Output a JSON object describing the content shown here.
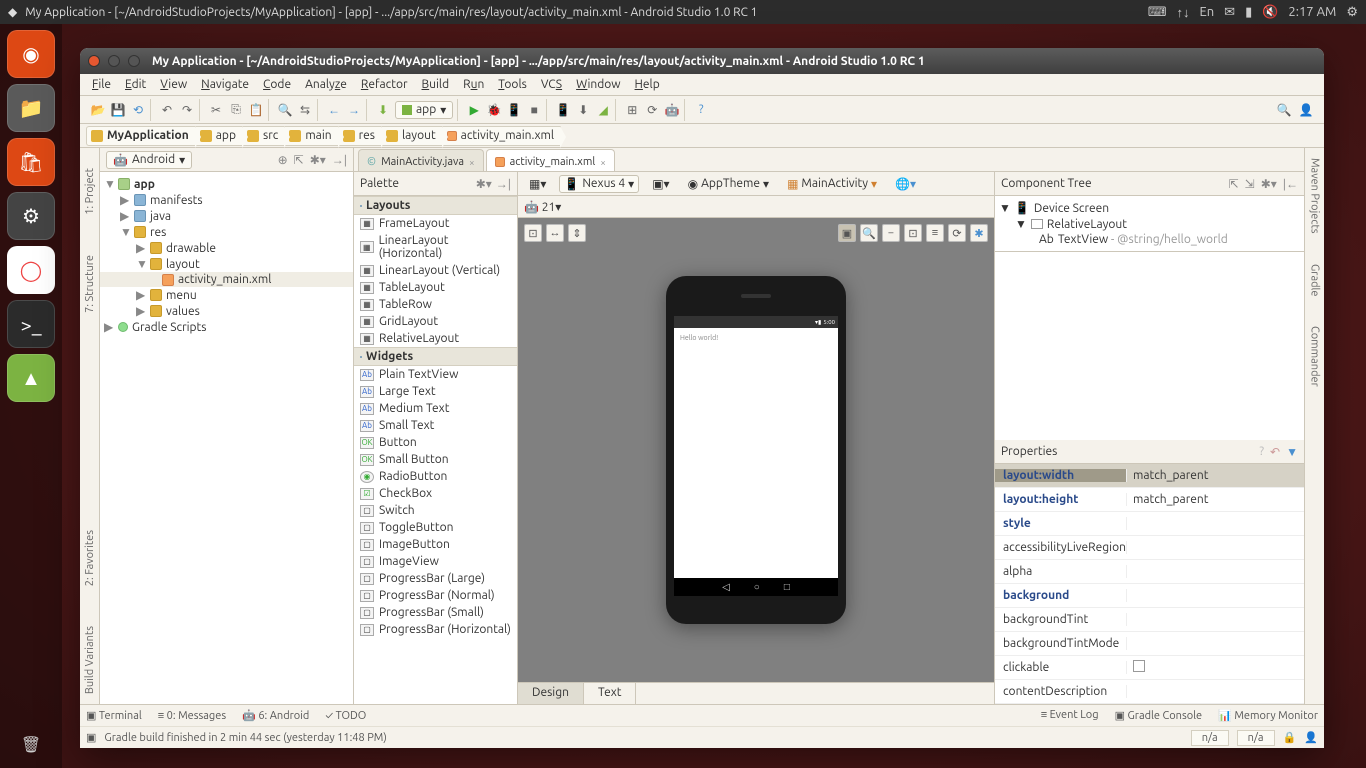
{
  "os": {
    "title": "My Application - [~/AndroidStudioProjects/MyApplication] - [app] - .../app/src/main/res/layout/activity_main.xml - Android Studio 1.0 RC 1",
    "time": "2:17 AM",
    "lang": "En"
  },
  "titlebar": "My Application - [~/AndroidStudioProjects/MyApplication] - [app] - .../app/src/main/res/layout/activity_main.xml - Android Studio 1.0 RC 1",
  "menu": [
    "File",
    "Edit",
    "View",
    "Navigate",
    "Code",
    "Analyze",
    "Refactor",
    "Build",
    "Run",
    "Tools",
    "VCS",
    "Window",
    "Help"
  ],
  "toolbar": {
    "run_config": "app"
  },
  "breadcrumb": [
    "MyApplication",
    "app",
    "src",
    "main",
    "res",
    "layout",
    "activity_main.xml"
  ],
  "project": {
    "viewmode": "Android",
    "tree": {
      "app": "app",
      "manifests": "manifests",
      "java": "java",
      "res": "res",
      "drawable": "drawable",
      "layout": "layout",
      "activity_main": "activity_main.xml",
      "menu": "menu",
      "values": "values",
      "gradle": "Gradle Scripts"
    }
  },
  "tabs": {
    "t1": "MainActivity.java",
    "t2": "activity_main.xml"
  },
  "palette": {
    "title": "Palette",
    "sections": {
      "layouts": "Layouts",
      "widgets": "Widgets"
    },
    "layouts": [
      "FrameLayout",
      "LinearLayout (Horizontal)",
      "LinearLayout (Vertical)",
      "TableLayout",
      "TableRow",
      "GridLayout",
      "RelativeLayout"
    ],
    "widgets": [
      "Plain TextView",
      "Large Text",
      "Medium Text",
      "Small Text",
      "Button",
      "Small Button",
      "RadioButton",
      "CheckBox",
      "Switch",
      "ToggleButton",
      "ImageButton",
      "ImageView",
      "ProgressBar (Large)",
      "ProgressBar (Normal)",
      "ProgressBar (Small)",
      "ProgressBar (Horizontal)"
    ]
  },
  "canvasbar": {
    "device": "Nexus 4",
    "theme": "AppTheme",
    "activity": "MainActivity",
    "api": "21"
  },
  "device": {
    "status_time": "5:00",
    "text": "Hello world!"
  },
  "design_tabs": {
    "design": "Design",
    "text": "Text"
  },
  "component_tree": {
    "title": "Component Tree",
    "root": "Device Screen",
    "l1": "RelativeLayout",
    "l2": "TextView",
    "l2_suffix": " - @string/hello_world"
  },
  "properties": {
    "title": "Properties",
    "rows": [
      {
        "k": "layout:width",
        "v": "match_parent",
        "bold": true,
        "sel": true
      },
      {
        "k": "layout:height",
        "v": "match_parent",
        "bold": true
      },
      {
        "k": "style",
        "v": "",
        "bold": true
      },
      {
        "k": "accessibilityLiveRegion",
        "v": ""
      },
      {
        "k": "alpha",
        "v": ""
      },
      {
        "k": "background",
        "v": "",
        "bold": true
      },
      {
        "k": "backgroundTint",
        "v": ""
      },
      {
        "k": "backgroundTintMode",
        "v": ""
      },
      {
        "k": "clickable",
        "v": "checkbox"
      },
      {
        "k": "contentDescription",
        "v": ""
      }
    ]
  },
  "rightstrip": [
    "Maven Projects",
    "Gradle",
    "Commander"
  ],
  "leftstrip": [
    "1: Project",
    "7: Structure",
    "2: Favorites",
    "Build Variants"
  ],
  "bottombar": {
    "terminal": "Terminal",
    "messages": "0: Messages",
    "android": "6: Android",
    "todo": "TODO",
    "eventlog": "Event Log",
    "gradle": "Gradle Console",
    "memory": "Memory Monitor"
  },
  "status": {
    "msg": "Gradle build finished in 2 min 44 sec (yesterday 11:48 PM)",
    "na1": "n/a",
    "na2": "n/a"
  }
}
